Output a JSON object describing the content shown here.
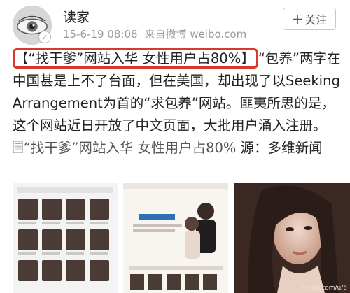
{
  "header": {
    "username": "读家",
    "date": "15-6-19 08:08",
    "source": "来自微博 weibo.com",
    "follow_label": "关注"
  },
  "post": {
    "headline": "【“找干爹”网站入华 女性用户占80%】",
    "body": "“包养”两字在中国甚是上不了台面，但在美国，却出现了以Seeking Arrangement为首的“求包养”网站。匪夷所思的是，这个网站近日开放了中文页面，大批用户涌入注册。",
    "link_text": "“找干爹”网站入华 女性用户占80%",
    "source_suffix": "源：多维新闻"
  },
  "images": [
    {
      "name": "website-listing-screenshot"
    },
    {
      "name": "website-banner-screenshot"
    },
    {
      "name": "portrait-photo",
      "watermark": "weibo.com/u/5"
    }
  ],
  "colors": {
    "highlight_border": "#d8392b",
    "meta_text": "#9a9a9a"
  }
}
